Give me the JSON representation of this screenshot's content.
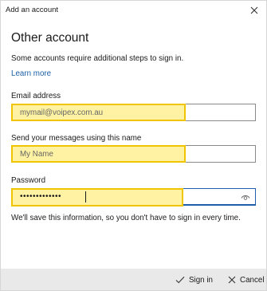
{
  "dialog": {
    "title": "Add an account"
  },
  "main": {
    "heading": "Other account",
    "description": "Some accounts require additional steps to sign in.",
    "learn_more": "Learn more"
  },
  "email": {
    "label": "Email address",
    "value": "mymail@voipex.com.au"
  },
  "name": {
    "label": "Send your messages using this name",
    "value": "My Name"
  },
  "password": {
    "label": "Password",
    "masked_value": "•••••••••••••"
  },
  "note": "We'll save this information, so you don't have to sign in every time.",
  "footer": {
    "signin_label": "Sign in",
    "cancel_label": "Cancel"
  },
  "colors": {
    "highlight_fill": "#fff3a3",
    "highlight_border": "#f0c400",
    "focus_border": "#1f5fa9",
    "link": "#1b5fa8",
    "footer_bg": "#e9e9e9"
  },
  "icons": {
    "close": "close-icon",
    "reveal": "eye-icon",
    "signin": "checkmark-icon",
    "cancel": "close-icon"
  }
}
